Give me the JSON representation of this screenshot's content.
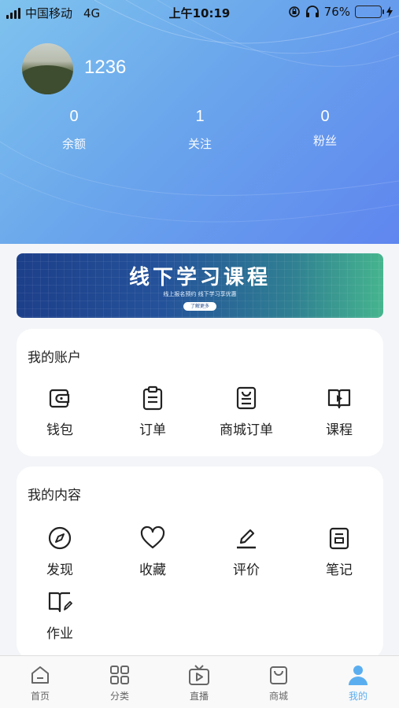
{
  "status_bar": {
    "carrier": "中国移动",
    "network": "4G",
    "time": "上午10:19",
    "battery": "76%",
    "battery_level": 0.76
  },
  "profile": {
    "username": "1236"
  },
  "stats": [
    {
      "value": "0",
      "label": "余额"
    },
    {
      "value": "1",
      "label": "关注"
    },
    {
      "value": "0",
      "label": "粉丝"
    }
  ],
  "banner": {
    "title": "线下学习课程",
    "subtitle": "线上报名预约 线下学习享优惠",
    "button": "了解更多"
  },
  "account": {
    "title": "我的账户",
    "items": [
      {
        "label": "钱包",
        "icon": "wallet-icon"
      },
      {
        "label": "订单",
        "icon": "clipboard-icon"
      },
      {
        "label": "商城订单",
        "icon": "shop-order-icon"
      },
      {
        "label": "课程",
        "icon": "course-book-icon"
      }
    ]
  },
  "content": {
    "title": "我的内容",
    "items": [
      {
        "label": "发现",
        "icon": "compass-icon"
      },
      {
        "label": "收藏",
        "icon": "heart-icon"
      },
      {
        "label": "评价",
        "icon": "pen-icon"
      },
      {
        "label": "笔记",
        "icon": "note-icon"
      },
      {
        "label": "作业",
        "icon": "homework-book-icon"
      }
    ]
  },
  "tabbar": {
    "items": [
      {
        "label": "首页",
        "icon": "home-icon"
      },
      {
        "label": "分类",
        "icon": "category-icon"
      },
      {
        "label": "直播",
        "icon": "live-tv-icon"
      },
      {
        "label": "商城",
        "icon": "shopping-bag-icon"
      },
      {
        "label": "我的",
        "icon": "user-icon",
        "active": true
      }
    ]
  },
  "colors": {
    "header_start": "#7fc3ee",
    "header_end": "#5f86ef",
    "active_tab": "#5aaef0",
    "battery": "#4cd964"
  }
}
